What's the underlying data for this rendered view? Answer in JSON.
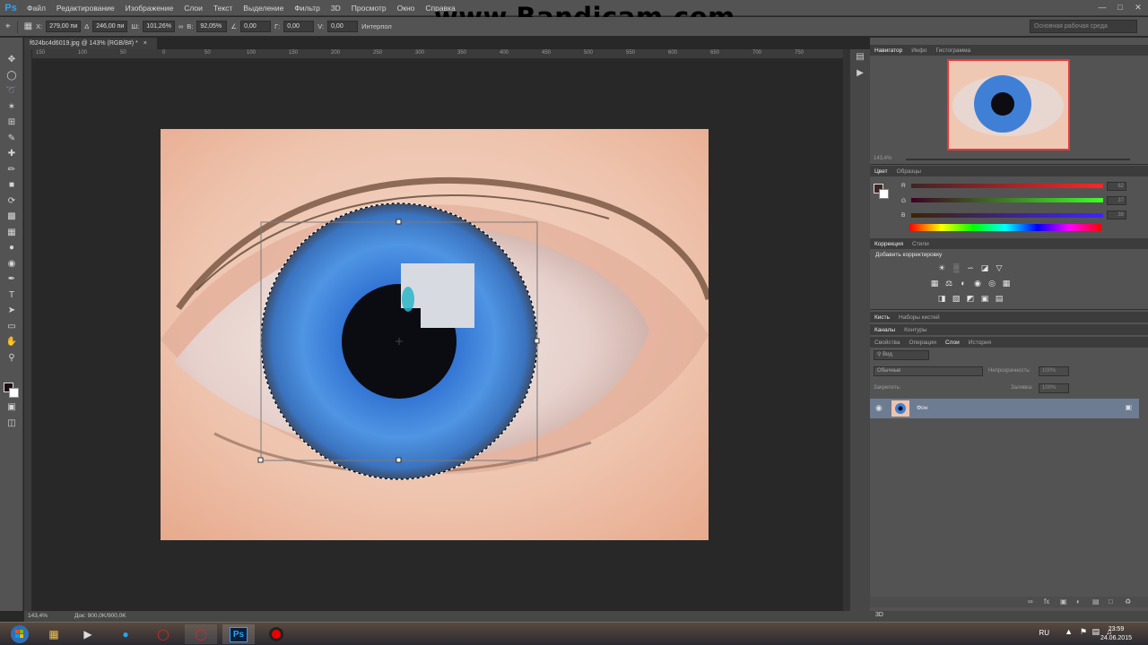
{
  "app": {
    "logo": "Ps"
  },
  "watermark": "www.Bandicam.com",
  "menu": [
    "Файл",
    "Редактирование",
    "Изображение",
    "Слои",
    "Текст",
    "Выделение",
    "Фильтр",
    "3D",
    "Просмотр",
    "Окно",
    "Справка"
  ],
  "options": {
    "x_label": "X:",
    "x_value": "279,00 пи",
    "w_label": "Ш:",
    "w_value": "101,26%",
    "h_label": "В:",
    "h_value": "92,05%",
    "y_value": "246,00 пи",
    "angle_value": "0,00",
    "hskew_label": "Г:",
    "hskew_value": "0,00",
    "vskew_label": "V:",
    "vskew_value": "0,00",
    "interp_label": "Интерпол",
    "workspace": "Основная рабочая среда"
  },
  "document": {
    "tab_title": "f624bc4d6019.jpg @ 143% (RGB/8#) *",
    "zoom": "143,4%",
    "doc_info": "Док: 900,0K/900,0K"
  },
  "ruler_ticks": [
    "150",
    "100",
    "50",
    "0",
    "50",
    "100",
    "150",
    "200",
    "250",
    "300",
    "350",
    "400",
    "450",
    "500",
    "550",
    "600",
    "650",
    "700",
    "750"
  ],
  "panels": {
    "navigator_tabs": [
      "Навигатор",
      "Инфо",
      "Гистограмма"
    ],
    "nav_zoom": "143,4%",
    "color_tabs": [
      "Цвет",
      "Образцы"
    ],
    "color_channels": [
      {
        "label": "R",
        "value": "62"
      },
      {
        "label": "G",
        "value": "37"
      },
      {
        "label": "B",
        "value": "38"
      }
    ],
    "adjust_tabs": [
      "Коррекция",
      "Стили"
    ],
    "adjust_title": "Добавить корректировку",
    "brush_tabs": [
      "Кисть",
      "Наборы кистей"
    ],
    "channel_tabs": [
      "Каналы",
      "Контуры"
    ],
    "layer_tabs": [
      "Свойства",
      "Операции",
      "Слои",
      "История"
    ],
    "layer_filter": "Вид",
    "blend_mode": "Обычные",
    "opacity_label": "Непрозрачность:",
    "opacity_value": "100%",
    "lock_label": "Закрепить:",
    "fill_label": "Заливка:",
    "fill_value": "100%",
    "layer_name": "Фон",
    "bottom_label": "3D"
  },
  "taskbar": {
    "lang": "RU",
    "time": "23:59",
    "date": "24.06.2015"
  },
  "colors": {
    "accent": "#2fa3f5",
    "layer_selected": "#6d7c93",
    "panel_bg": "#535353"
  }
}
